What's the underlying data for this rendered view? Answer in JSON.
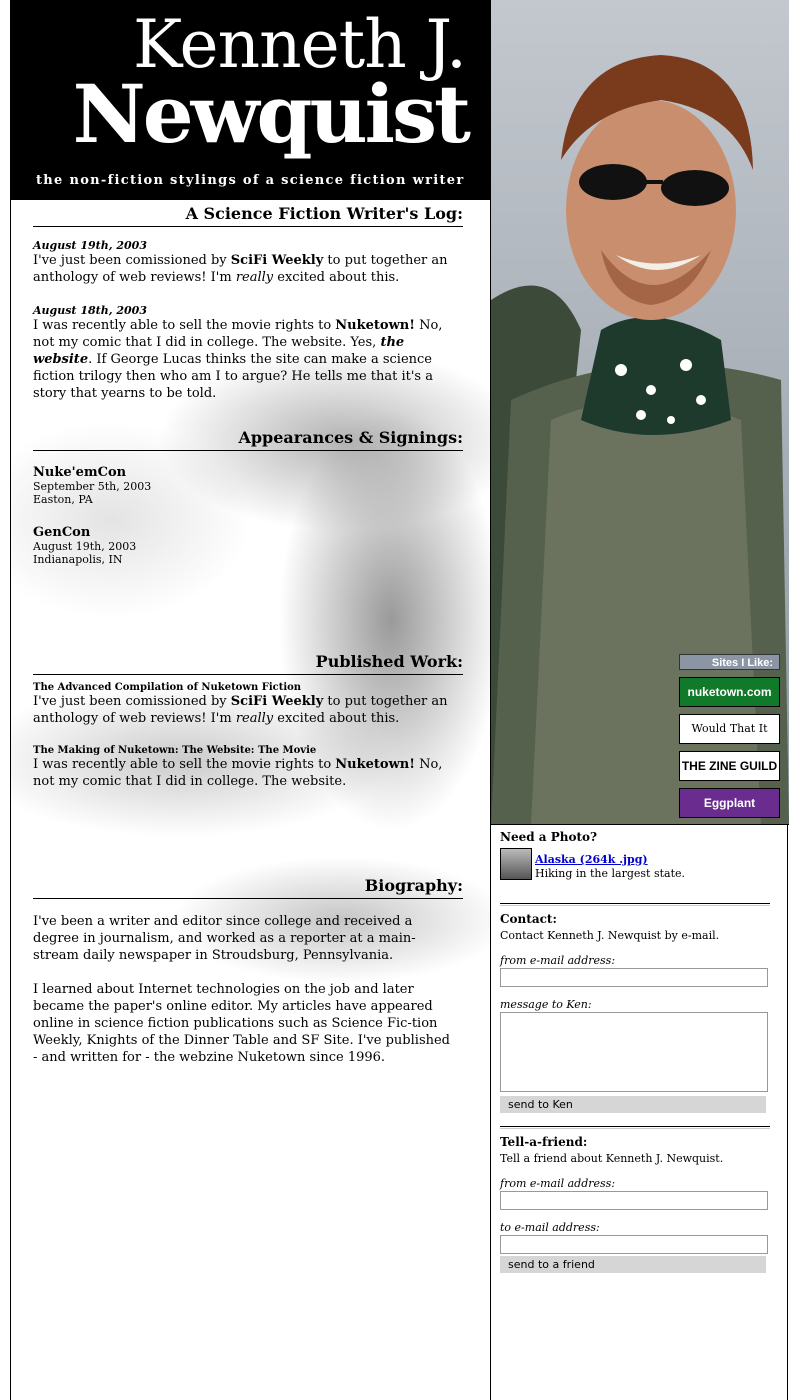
{
  "masthead": {
    "first": "Kenneth J.",
    "last": "Newquist",
    "tagline": "the non-fiction stylings of a science fiction writer"
  },
  "log": {
    "heading": "A Science Fiction Writer's Log:",
    "entries": [
      {
        "date": "August 19th, 2003",
        "t1": "I've just been comissioned by ",
        "b1": "SciFi Weekly",
        "t2": " to put together an anthology of web reviews! I'm ",
        "i1": "really",
        "t3": " excited about this."
      },
      {
        "date": "August 18th, 2003",
        "t1": "I was recently able to sell the movie rights to ",
        "b1": "Nuketown!",
        "t2": " No, not my comic that I did in college. The website. Yes, ",
        "bi1": "the website",
        "t3": ". If George Lucas thinks the site can make a science fiction trilogy then who am I to argue? He tells me that it's a story that yearns to be told."
      }
    ]
  },
  "appearances": {
    "heading": "Appearances & Signings:",
    "items": [
      {
        "name": "Nuke'emCon",
        "date": "September 5th, 2003",
        "place": "Easton, PA"
      },
      {
        "name": "GenCon",
        "date": "August 19th, 2003",
        "place": "Indianapolis, IN"
      }
    ]
  },
  "published": {
    "heading": "Published Work:",
    "items": [
      {
        "title": "The Advanced Compilation of Nuketown Fiction",
        "t1": "I've just been comissioned by ",
        "b1": "SciFi Weekly",
        "t2": " to put together an anthology of web reviews! I'm ",
        "i1": "really",
        "t3": " excited about this."
      },
      {
        "title": "The Making of Nuketown: The Website: The Movie",
        "t1": "I was recently able to sell the movie rights to ",
        "b1": "Nuketown!",
        "t2": " No, not my comic that I did in college. The website."
      }
    ]
  },
  "biography": {
    "heading": "Biography:",
    "p1": "I've been a writer and editor since college and received a degree in journalism, and worked as a reporter at a main-stream daily newspaper in Stroudsburg, Pennsylvania.",
    "p2": "I learned about Internet technologies on the job and later became the paper's online editor. My articles have appeared online in science fiction publications such as Science Fic-tion Weekly, Knights of the Dinner Table and SF Site. I've published - and written for - the webzine Nuketown since 1996."
  },
  "sites": {
    "label": "Sites I Like:",
    "items": [
      "nuketown.com ...what if?",
      "Would That It Were",
      "THE ZINE GUILD",
      "Eggplant LITERARY PRODUCTIONS"
    ]
  },
  "photo_block": {
    "heading": "Need a Photo?",
    "link": "Alaska (264k .jpg)",
    "caption": "Hiking in the largest state."
  },
  "contact": {
    "heading": "Contact:",
    "text": "Contact Kenneth J. Newquist by e-mail.",
    "from_label": "from e-mail address:",
    "from_value": "",
    "message_label": "message to Ken:",
    "message_value": "",
    "button": "send to Ken"
  },
  "tell": {
    "heading": "Tell-a-friend:",
    "text": "Tell a friend about Kenneth J. Newquist.",
    "from_label": "from e-mail address:",
    "from_value": "",
    "to_label": "to e-mail address:",
    "to_value": "",
    "button": "send to a friend"
  },
  "colors": {
    "masthead_bg": "#000000",
    "link": "#0000cc",
    "button_bg": "#d6d6d6"
  }
}
